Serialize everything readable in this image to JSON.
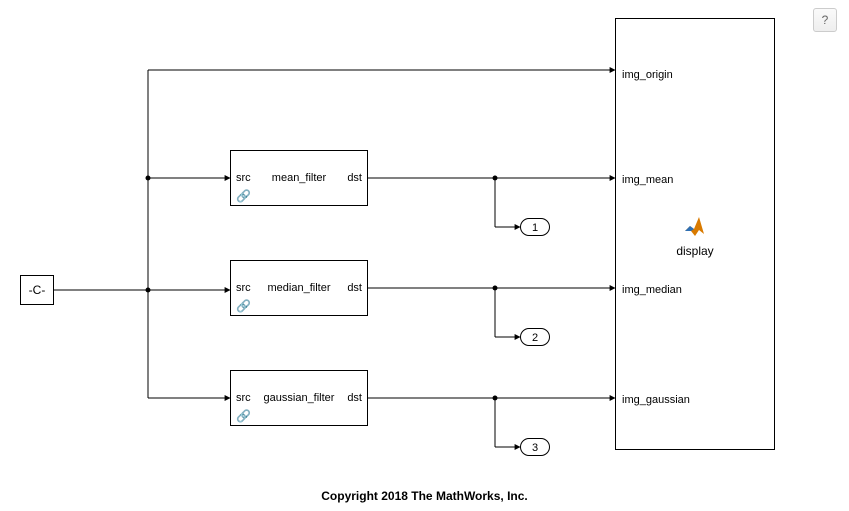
{
  "help_button": {
    "label": "?"
  },
  "constant": {
    "label": "-C-"
  },
  "filters": {
    "mean": {
      "src": "src",
      "name": "mean_filter",
      "dst": "dst"
    },
    "median": {
      "src": "src",
      "name": "median_filter",
      "dst": "dst"
    },
    "gaussian": {
      "src": "src",
      "name": "gaussian_filter",
      "dst": "dst"
    }
  },
  "outports": {
    "p1": "1",
    "p2": "2",
    "p3": "3"
  },
  "display": {
    "caption": "display",
    "ports": {
      "origin": "img_origin",
      "mean": "img_mean",
      "median": "img_median",
      "gaussian": "img_gaussian"
    }
  },
  "copyright": "Copyright 2018 The MathWorks, Inc."
}
